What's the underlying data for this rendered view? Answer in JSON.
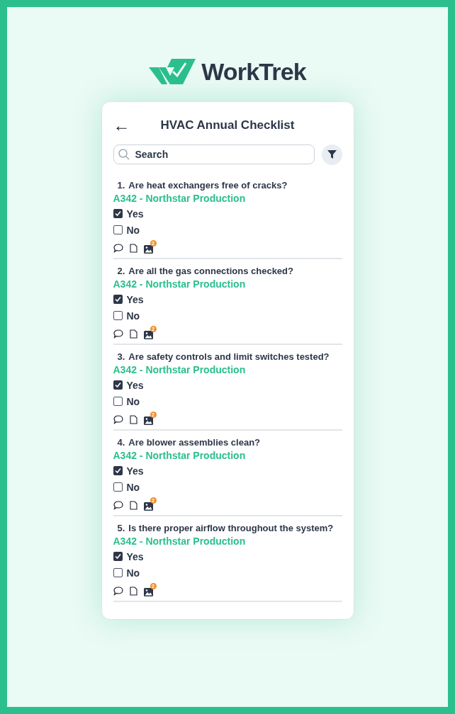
{
  "logo": {
    "text": "WorkTrek"
  },
  "header": {
    "back": "←",
    "title": "HVAC Annual Checklist"
  },
  "search": {
    "placeholder": "Search"
  },
  "questions": [
    {
      "number": "1.",
      "text": "Are heat exchangers free of cracks?",
      "asset": "A342 - Northstar Production",
      "options": [
        {
          "label": "Yes",
          "checked": true
        },
        {
          "label": "No",
          "checked": false
        }
      ],
      "photo_count": "2"
    },
    {
      "number": "2.",
      "text": "Are all the gas connections checked?",
      "asset": "A342 - Northstar Production",
      "options": [
        {
          "label": "Yes",
          "checked": true
        },
        {
          "label": "No",
          "checked": false
        }
      ],
      "photo_count": "2"
    },
    {
      "number": "3.",
      "text": "Are safety controls and limit switches tested?",
      "asset": "A342 - Northstar Production",
      "options": [
        {
          "label": "Yes",
          "checked": true
        },
        {
          "label": "No",
          "checked": false
        }
      ],
      "photo_count": "2"
    },
    {
      "number": "4.",
      "text": "Are blower assemblies clean?",
      "asset": "A342 - Northstar Production",
      "options": [
        {
          "label": "Yes",
          "checked": true
        },
        {
          "label": "No",
          "checked": false
        }
      ],
      "photo_count": "2"
    },
    {
      "number": "5.",
      "text": "Is there proper airflow throughout the system?",
      "asset": "A342 - Northstar Production",
      "options": [
        {
          "label": "Yes",
          "checked": true
        },
        {
          "label": "No",
          "checked": false
        }
      ],
      "photo_count": "2"
    }
  ]
}
